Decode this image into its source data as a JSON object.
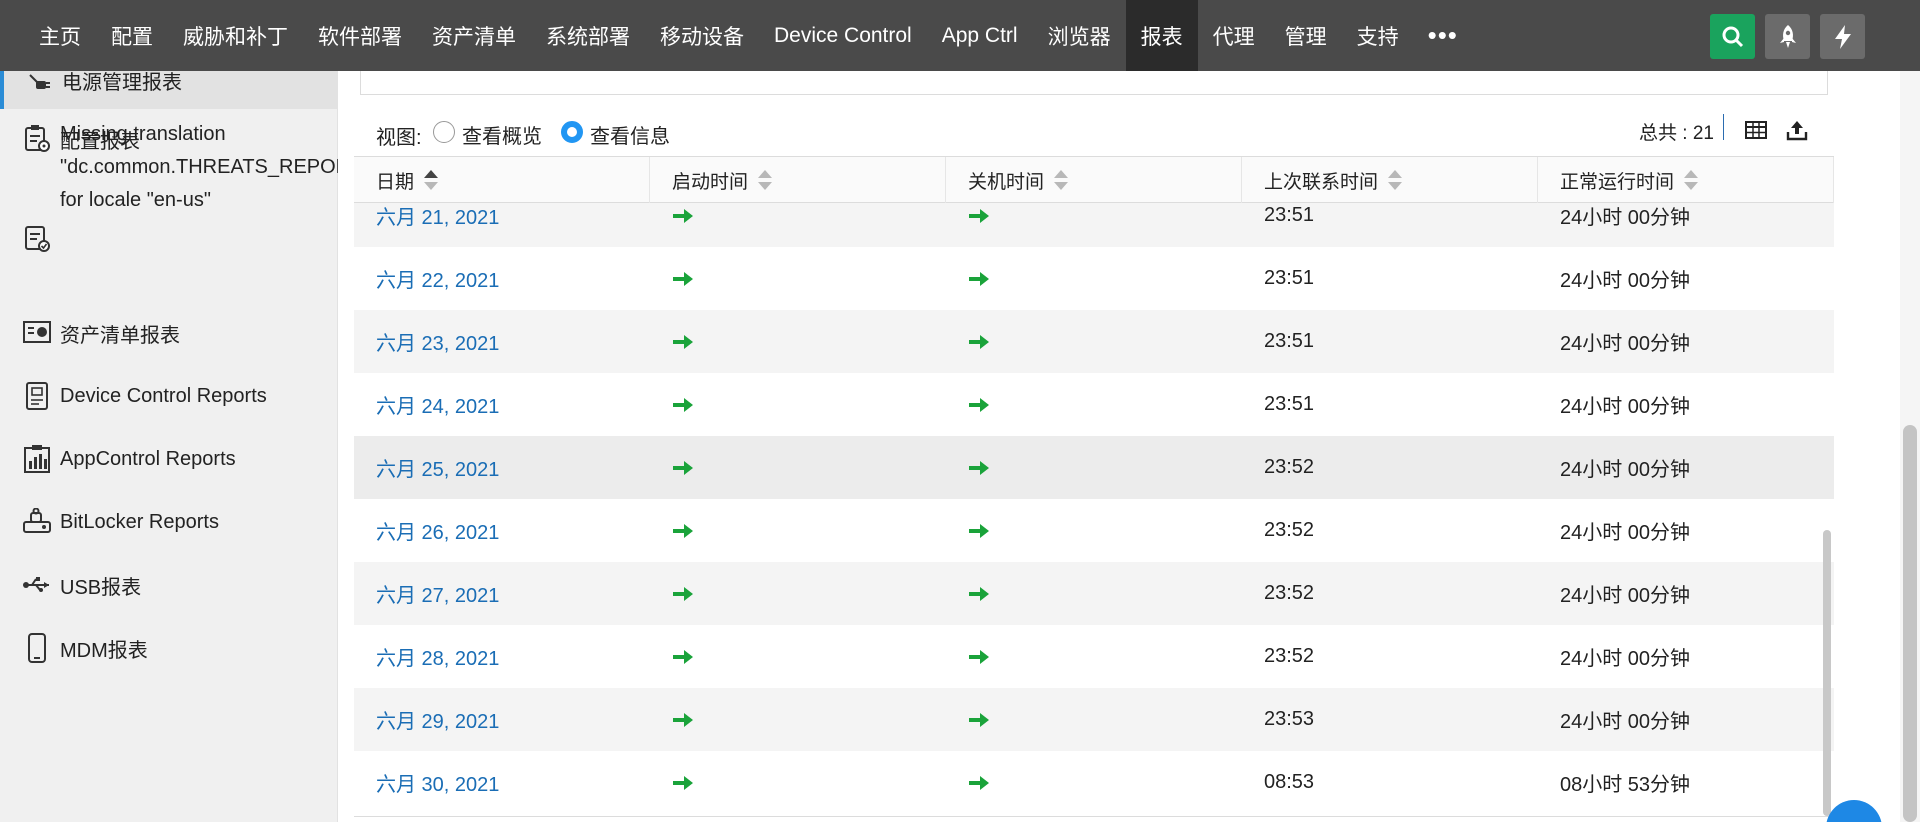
{
  "nav": {
    "items": [
      "主页",
      "配置",
      "威胁和补丁",
      "软件部署",
      "资产清单",
      "系统部署",
      "移动设备",
      "Device Control",
      "App Ctrl",
      "浏览器",
      "报表",
      "代理",
      "管理",
      "支持"
    ],
    "more": "•••",
    "active_index": 10,
    "right_buttons": [
      "search-icon",
      "rocket-icon",
      "lightning-icon"
    ]
  },
  "sidebar": {
    "active_label": "电源管理报表",
    "items": [
      {
        "label": "配置报表",
        "icon": "config-report-icon"
      },
      {
        "label": "资产清单报表",
        "icon": "inventory-report-icon"
      },
      {
        "label": "Device Control Reports",
        "icon": "device-control-icon"
      },
      {
        "label": "AppControl Reports",
        "icon": "app-control-icon"
      },
      {
        "label": "BitLocker Reports",
        "icon": "bitlocker-icon"
      },
      {
        "label": "USB报表",
        "icon": "usb-icon"
      },
      {
        "label": "MDM报表",
        "icon": "mobile-icon"
      }
    ],
    "missing_translation": {
      "line1": "Missing translation",
      "line2": "\"dc.common.THREATS_REPORTS\"",
      "line3": "for locale \"en-us\""
    }
  },
  "toolbar": {
    "view_label": "视图:",
    "option_summary": "查看概览",
    "option_details": "查看信息",
    "selected": "查看信息",
    "total": "总共 : 21"
  },
  "table": {
    "columns": [
      "日期",
      "启动时间",
      "关机时间",
      "上次联系时间",
      "正常运行时间"
    ],
    "rows": [
      {
        "date": "六月 21, 2021",
        "last_contact": "23:51",
        "uptime": "24小时 00分钟"
      },
      {
        "date": "六月 22, 2021",
        "last_contact": "23:51",
        "uptime": "24小时 00分钟"
      },
      {
        "date": "六月 23, 2021",
        "last_contact": "23:51",
        "uptime": "24小时 00分钟"
      },
      {
        "date": "六月 24, 2021",
        "last_contact": "23:51",
        "uptime": "24小时 00分钟"
      },
      {
        "date": "六月 25, 2021",
        "last_contact": "23:52",
        "uptime": "24小时 00分钟"
      },
      {
        "date": "六月 26, 2021",
        "last_contact": "23:52",
        "uptime": "24小时 00分钟"
      },
      {
        "date": "六月 27, 2021",
        "last_contact": "23:52",
        "uptime": "24小时 00分钟"
      },
      {
        "date": "六月 28, 2021",
        "last_contact": "23:52",
        "uptime": "24小时 00分钟"
      },
      {
        "date": "六月 29, 2021",
        "last_contact": "23:53",
        "uptime": "24小时 00分钟"
      },
      {
        "date": "六月 30, 2021",
        "last_contact": "08:53",
        "uptime": "08小时 53分钟"
      }
    ]
  },
  "colors": {
    "nav_bg": "#4a4a4a",
    "search_button": "#1aa35d",
    "link": "#1a6db5",
    "arrow_green": "#1aa33a",
    "radio_selected": "#2196f3"
  }
}
